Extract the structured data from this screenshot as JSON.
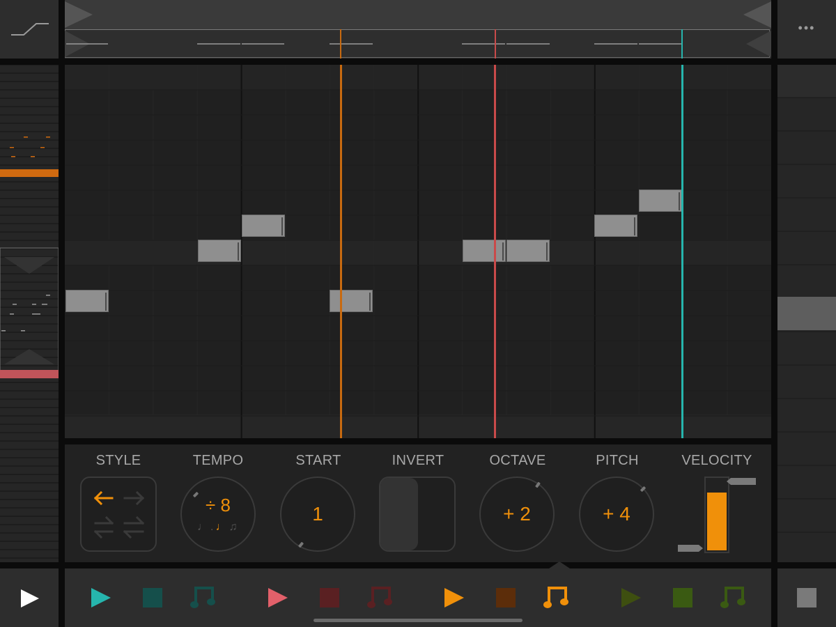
{
  "header": {
    "curve_icon": "ramp-curve-icon",
    "menu_icon": "more-dots-icon",
    "menu_glyph": "•••"
  },
  "controls": {
    "style": {
      "label": "STYLE"
    },
    "tempo": {
      "label": "TEMPO",
      "value": "÷ 8"
    },
    "start": {
      "label": "START",
      "value": "1"
    },
    "invert": {
      "label": "INVERT"
    },
    "octave": {
      "label": "OCTAVE",
      "value": "+ 2"
    },
    "pitch": {
      "label": "PITCH",
      "value": "+ 4"
    },
    "velocity": {
      "label": "VELOCITY",
      "level": 0.78
    }
  },
  "sequencers": [
    {
      "color": "#26b5ad",
      "dim": "#154f4b"
    },
    {
      "color": "#e2606a",
      "dim": "#5a2022"
    },
    {
      "color": "#f0900a",
      "dim": "#5c2d0a"
    },
    {
      "color": "#3e4f10",
      "dim": "#3a5a12"
    }
  ],
  "active_sequencer": 2,
  "colors": {
    "accent": "#f0900a",
    "red": "#c94a4a",
    "teal": "#26b5ad"
  }
}
